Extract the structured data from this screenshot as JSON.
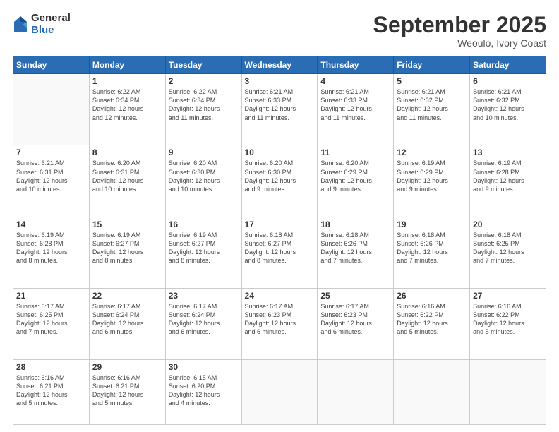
{
  "logo": {
    "general": "General",
    "blue": "Blue"
  },
  "header": {
    "month": "September 2025",
    "location": "Weoulo, Ivory Coast"
  },
  "weekdays": [
    "Sunday",
    "Monday",
    "Tuesday",
    "Wednesday",
    "Thursday",
    "Friday",
    "Saturday"
  ],
  "weeks": [
    [
      {
        "day": "",
        "info": ""
      },
      {
        "day": "1",
        "info": "Sunrise: 6:22 AM\nSunset: 6:34 PM\nDaylight: 12 hours\nand 12 minutes."
      },
      {
        "day": "2",
        "info": "Sunrise: 6:22 AM\nSunset: 6:34 PM\nDaylight: 12 hours\nand 11 minutes."
      },
      {
        "day": "3",
        "info": "Sunrise: 6:21 AM\nSunset: 6:33 PM\nDaylight: 12 hours\nand 11 minutes."
      },
      {
        "day": "4",
        "info": "Sunrise: 6:21 AM\nSunset: 6:33 PM\nDaylight: 12 hours\nand 11 minutes."
      },
      {
        "day": "5",
        "info": "Sunrise: 6:21 AM\nSunset: 6:32 PM\nDaylight: 12 hours\nand 11 minutes."
      },
      {
        "day": "6",
        "info": "Sunrise: 6:21 AM\nSunset: 6:32 PM\nDaylight: 12 hours\nand 10 minutes."
      }
    ],
    [
      {
        "day": "7",
        "info": "Sunrise: 6:21 AM\nSunset: 6:31 PM\nDaylight: 12 hours\nand 10 minutes."
      },
      {
        "day": "8",
        "info": "Sunrise: 6:20 AM\nSunset: 6:31 PM\nDaylight: 12 hours\nand 10 minutes."
      },
      {
        "day": "9",
        "info": "Sunrise: 6:20 AM\nSunset: 6:30 PM\nDaylight: 12 hours\nand 10 minutes."
      },
      {
        "day": "10",
        "info": "Sunrise: 6:20 AM\nSunset: 6:30 PM\nDaylight: 12 hours\nand 9 minutes."
      },
      {
        "day": "11",
        "info": "Sunrise: 6:20 AM\nSunset: 6:29 PM\nDaylight: 12 hours\nand 9 minutes."
      },
      {
        "day": "12",
        "info": "Sunrise: 6:19 AM\nSunset: 6:29 PM\nDaylight: 12 hours\nand 9 minutes."
      },
      {
        "day": "13",
        "info": "Sunrise: 6:19 AM\nSunset: 6:28 PM\nDaylight: 12 hours\nand 9 minutes."
      }
    ],
    [
      {
        "day": "14",
        "info": "Sunrise: 6:19 AM\nSunset: 6:28 PM\nDaylight: 12 hours\nand 8 minutes."
      },
      {
        "day": "15",
        "info": "Sunrise: 6:19 AM\nSunset: 6:27 PM\nDaylight: 12 hours\nand 8 minutes."
      },
      {
        "day": "16",
        "info": "Sunrise: 6:19 AM\nSunset: 6:27 PM\nDaylight: 12 hours\nand 8 minutes."
      },
      {
        "day": "17",
        "info": "Sunrise: 6:18 AM\nSunset: 6:27 PM\nDaylight: 12 hours\nand 8 minutes."
      },
      {
        "day": "18",
        "info": "Sunrise: 6:18 AM\nSunset: 6:26 PM\nDaylight: 12 hours\nand 7 minutes."
      },
      {
        "day": "19",
        "info": "Sunrise: 6:18 AM\nSunset: 6:26 PM\nDaylight: 12 hours\nand 7 minutes."
      },
      {
        "day": "20",
        "info": "Sunrise: 6:18 AM\nSunset: 6:25 PM\nDaylight: 12 hours\nand 7 minutes."
      }
    ],
    [
      {
        "day": "21",
        "info": "Sunrise: 6:17 AM\nSunset: 6:25 PM\nDaylight: 12 hours\nand 7 minutes."
      },
      {
        "day": "22",
        "info": "Sunrise: 6:17 AM\nSunset: 6:24 PM\nDaylight: 12 hours\nand 6 minutes."
      },
      {
        "day": "23",
        "info": "Sunrise: 6:17 AM\nSunset: 6:24 PM\nDaylight: 12 hours\nand 6 minutes."
      },
      {
        "day": "24",
        "info": "Sunrise: 6:17 AM\nSunset: 6:23 PM\nDaylight: 12 hours\nand 6 minutes."
      },
      {
        "day": "25",
        "info": "Sunrise: 6:17 AM\nSunset: 6:23 PM\nDaylight: 12 hours\nand 6 minutes."
      },
      {
        "day": "26",
        "info": "Sunrise: 6:16 AM\nSunset: 6:22 PM\nDaylight: 12 hours\nand 5 minutes."
      },
      {
        "day": "27",
        "info": "Sunrise: 6:16 AM\nSunset: 6:22 PM\nDaylight: 12 hours\nand 5 minutes."
      }
    ],
    [
      {
        "day": "28",
        "info": "Sunrise: 6:16 AM\nSunset: 6:21 PM\nDaylight: 12 hours\nand 5 minutes."
      },
      {
        "day": "29",
        "info": "Sunrise: 6:16 AM\nSunset: 6:21 PM\nDaylight: 12 hours\nand 5 minutes."
      },
      {
        "day": "30",
        "info": "Sunrise: 6:15 AM\nSunset: 6:20 PM\nDaylight: 12 hours\nand 4 minutes."
      },
      {
        "day": "",
        "info": ""
      },
      {
        "day": "",
        "info": ""
      },
      {
        "day": "",
        "info": ""
      },
      {
        "day": "",
        "info": ""
      }
    ]
  ]
}
